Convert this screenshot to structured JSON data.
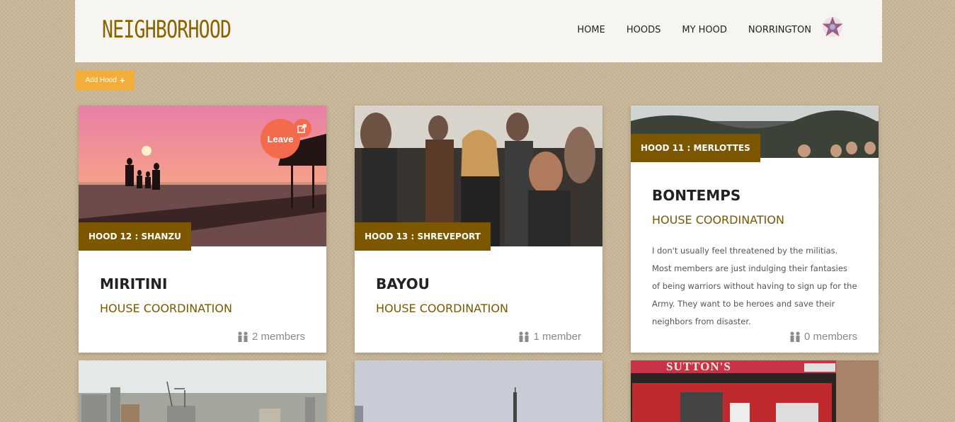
{
  "brand": "NEIGHBORHOOD",
  "nav": {
    "home": "HOME",
    "hoods": "HOODS",
    "my_hood": "MY HOOD",
    "user": "NORRINGTON"
  },
  "add_hood": "Add Hood",
  "cards": [
    {
      "tag": "HOOD 12 : SHANZU",
      "title": "MIRITINI",
      "subtitle": "HOUSE COORDINATION",
      "members": "2 members",
      "leave": "Leave"
    },
    {
      "tag": "HOOD 13 : SHREVEPORT",
      "title": "BAYOU",
      "subtitle": "HOUSE COORDINATION",
      "members": "1 member"
    },
    {
      "tag": "HOOD 11 : MERLOTTES",
      "title": "BONTEMPS",
      "subtitle": "HOUSE COORDINATION",
      "description": "I don't usually feel threatened by the militias. Most members are just indulging their fantasies of being warriors without having to sign up for the Army. They want to be heroes and save their neighbors from disaster.",
      "members": "0 members"
    }
  ],
  "bottom_signage": "SUTTON'S",
  "colors": {
    "brand": "#8a6300",
    "tag": "#7d5600",
    "accent_button": "#f3ad3b",
    "leave": "#f46a4d"
  }
}
